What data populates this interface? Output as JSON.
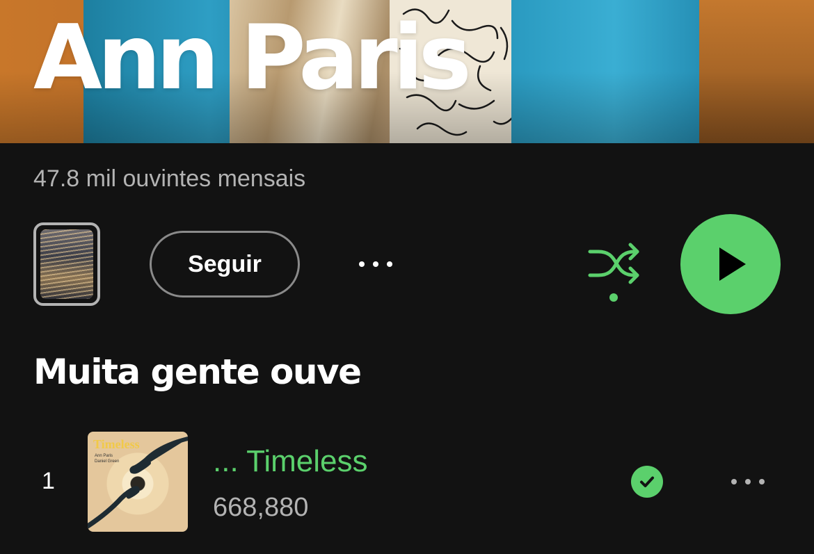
{
  "artist": {
    "name": "Ann Paris",
    "monthly_listeners": "47.8 mil ouvintes mensais"
  },
  "actions": {
    "follow_label": "Seguir",
    "more_icon": "more-horizontal-icon",
    "shuffle_icon": "shuffle-icon",
    "play_icon": "play-icon"
  },
  "popular": {
    "title": "Muita gente ouve",
    "tracks": [
      {
        "index": "1",
        "title": "... Timeless",
        "plays": "668,880",
        "cover_title": "Timeless",
        "cover_artist_line1": "Ann Paris",
        "cover_artist_line2": "Daniel Green",
        "status_icon": "downloaded-check-icon",
        "more_icon": "more-horizontal-icon"
      }
    ]
  },
  "colors": {
    "background": "#121212",
    "accent": "#5bd06c",
    "secondary_text": "#b3b3b3",
    "primary_text": "#ffffff"
  }
}
